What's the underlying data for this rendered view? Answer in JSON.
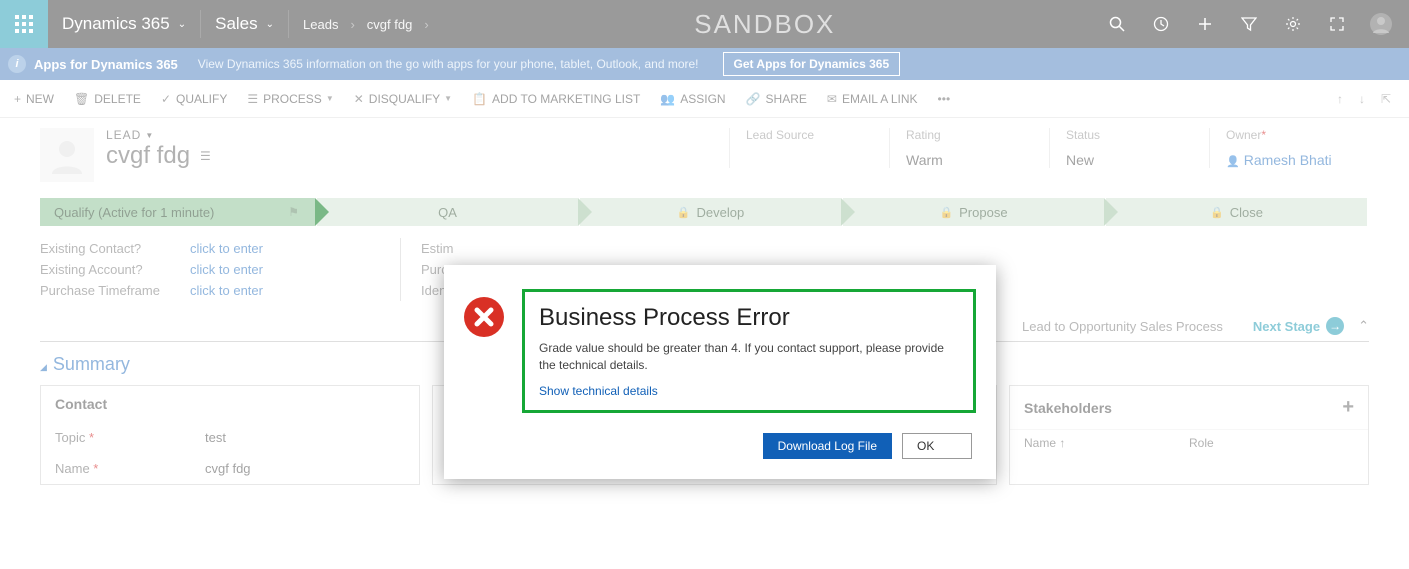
{
  "colors": {
    "teal": "#048eaa",
    "navbg": "#212121",
    "link": "#1160b7",
    "green": "#16a736"
  },
  "topnav": {
    "brand": "Dynamics 365",
    "area": "Sales",
    "breadcrumb": [
      "Leads",
      "cvgf fdg"
    ],
    "sandbox": "SANDBOX"
  },
  "infobar": {
    "title": "Apps for Dynamics 365",
    "desc": "View Dynamics 365 information on the go with apps for your phone, tablet, Outlook, and more!",
    "button": "Get Apps for Dynamics 365"
  },
  "commands": {
    "new": "NEW",
    "delete": "DELETE",
    "qualify": "QUALIFY",
    "process": "PROCESS",
    "disqualify": "DISQUALIFY",
    "addmkt": "ADD TO MARKETING LIST",
    "assign": "ASSIGN",
    "share": "SHARE",
    "email": "EMAIL A LINK"
  },
  "header": {
    "entity": "LEAD",
    "title": "cvgf fdg",
    "fields": {
      "leadsource": {
        "label": "Lead Source",
        "value": ""
      },
      "rating": {
        "label": "Rating",
        "value": "Warm"
      },
      "status": {
        "label": "Status",
        "value": "New"
      },
      "owner": {
        "label": "Owner",
        "value": "Ramesh Bhati",
        "required": true
      }
    }
  },
  "process": {
    "stages": [
      {
        "label": "Qualify (Active for 1 minute)",
        "active": true
      },
      {
        "label": "QA"
      },
      {
        "label": "Develop",
        "locked": true
      },
      {
        "label": "Propose",
        "locked": true
      },
      {
        "label": "Close",
        "locked": true
      }
    ],
    "fields": {
      "col1": [
        {
          "label": "Existing Contact?",
          "value": "click to enter"
        },
        {
          "label": "Existing Account?",
          "value": "click to enter"
        },
        {
          "label": "Purchase Timeframe",
          "value": "click to enter"
        }
      ],
      "col2": [
        {
          "label": "Estim"
        },
        {
          "label": "Purc"
        },
        {
          "label": "Iden"
        }
      ]
    },
    "name": "Lead to Opportunity Sales Process",
    "next": "Next Stage"
  },
  "summary": {
    "title": "Summary",
    "contact": {
      "title": "Contact",
      "rows": [
        {
          "label": "Topic",
          "required": true,
          "value": "test"
        },
        {
          "label": "Name",
          "required": true,
          "value": "cvgf fdg"
        }
      ]
    },
    "stakeholders": {
      "title": "Stakeholders",
      "cols": [
        "Name ↑",
        "Role"
      ]
    }
  },
  "dialog": {
    "title": "Business Process Error",
    "message": "Grade value should be greater than 4. If you contact support, please provide the technical details.",
    "details": "Show technical details",
    "download": "Download Log File",
    "ok": "OK"
  }
}
